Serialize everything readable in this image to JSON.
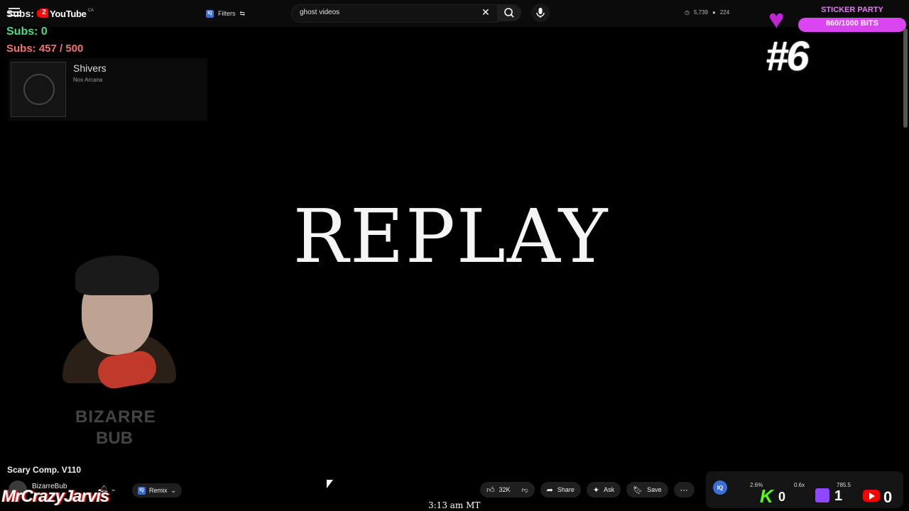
{
  "topbar": {
    "logo_text": "YouTube",
    "region": "CA",
    "filters_label": "Filters",
    "ext_badge": "IQ",
    "search_value": "ghost videos",
    "stat_views": "5,739",
    "stat_count": "224"
  },
  "overlay": {
    "subs_label": "Subs:",
    "subs_badge": "2",
    "subs_zero": "Subs: 0",
    "subs_goal": "Subs: 457 / 500",
    "sticker_title": "STICKER PARTY",
    "sticker_bits": "860/1000 BITS",
    "episode": "#6",
    "sticker_progress": 0.86
  },
  "now_playing": {
    "title": "Shivers",
    "artist": "Nox Arcana"
  },
  "player": {
    "replay_text": "REPLAY"
  },
  "webcam": {
    "watermark_line1": "BIZARRE",
    "watermark_line2": "BUB"
  },
  "video": {
    "title": "Scary Comp. V110",
    "channel": "BizarreBub",
    "remix_label": "Remix",
    "likes": "32K",
    "share_label": "Share",
    "ask_label": "Ask",
    "save_label": "Save"
  },
  "stream": {
    "overlay_name": "MrCrazyJarvis",
    "clock": "3:13 am MT",
    "stat_a": "2.6%",
    "stat_b": "0.6x",
    "stat_c": "785.5",
    "kick_count": "0",
    "twitch_count": "1",
    "youtube_count": "0"
  },
  "colors": {
    "subs_green": "#4ade80",
    "subs_red": "#f87171",
    "sticker_pink": "#d946ef",
    "kick_green": "#53fc18",
    "twitch_purple": "#9146ff",
    "youtube_red": "#ff0000"
  },
  "icons": [
    "menu-icon",
    "search-icon",
    "close-icon",
    "mic-icon",
    "like-icon",
    "dislike-icon",
    "share-icon",
    "ask-icon",
    "save-icon",
    "more-icon",
    "bell-icon",
    "heart-icon"
  ]
}
